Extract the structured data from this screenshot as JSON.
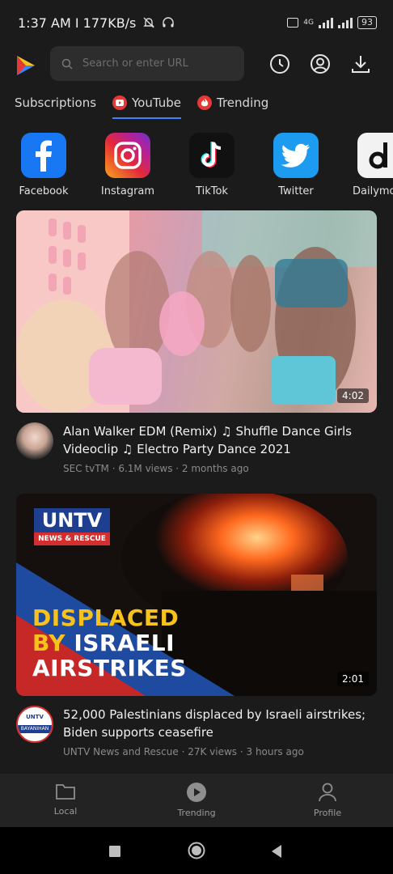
{
  "status_bar": {
    "time_speed": "1:37 AM I 177KB/s",
    "network_label": "4G",
    "battery": "93"
  },
  "header": {
    "search_placeholder": "Search or enter URL",
    "logo_icon": "play-logo-icon",
    "icons": [
      "history-icon",
      "account-icon",
      "download-icon"
    ]
  },
  "tabs": [
    {
      "label": "Subscriptions",
      "icon": null
    },
    {
      "label": "YouTube",
      "icon": "youtube-icon",
      "active": true
    },
    {
      "label": "Trending",
      "icon": "fire-icon"
    }
  ],
  "sites": [
    {
      "label": "Facebook",
      "icon": "facebook-icon",
      "color": "#1877f2"
    },
    {
      "label": "Instagram",
      "icon": "instagram-icon",
      "color": "#d6249f"
    },
    {
      "label": "TikTok",
      "icon": "tiktok-icon",
      "color": "#111111"
    },
    {
      "label": "Twitter",
      "icon": "twitter-icon",
      "color": "#1d9bf0"
    },
    {
      "label": "Dailymot",
      "icon": "dailymotion-icon",
      "color": "#f2f2f2"
    }
  ],
  "videos": [
    {
      "title": "Alan Walker EDM (Remix) ♫ Shuffle Dance Girls Videoclip ♫ Electro Party Dance 2021",
      "meta": "SEC tvTM · 6.1M views · 2 months ago",
      "duration": "4:02"
    },
    {
      "title": "52,000 Palestinians displaced by Israeli airstrikes; Biden supports ceasefire",
      "meta": "UNTV News and Rescue · 27K views · 3 hours ago",
      "duration": "2:01",
      "thumb_text": {
        "brand": "UNTV",
        "brand_sub": "NEWS & RESCUE",
        "line1": "DISPLACED",
        "line2_a": "BY ",
        "line2_b": "ISRAELI",
        "line3": "AIRSTRIKES"
      },
      "avatar_text": {
        "top": "UNTV",
        "bottom": "BAYANIHAN"
      }
    }
  ],
  "bottom_nav": [
    {
      "label": "Local",
      "icon": "folder-icon"
    },
    {
      "label": "Trending",
      "icon": "trending-disc-icon"
    },
    {
      "label": "Profile",
      "icon": "profile-icon"
    }
  ],
  "colors": {
    "background": "#1b1b1b",
    "accent": "#3b84ff",
    "youtube_red": "#e53935",
    "untv_red": "#d32f2f",
    "untv_yellow": "#f6c21b"
  }
}
